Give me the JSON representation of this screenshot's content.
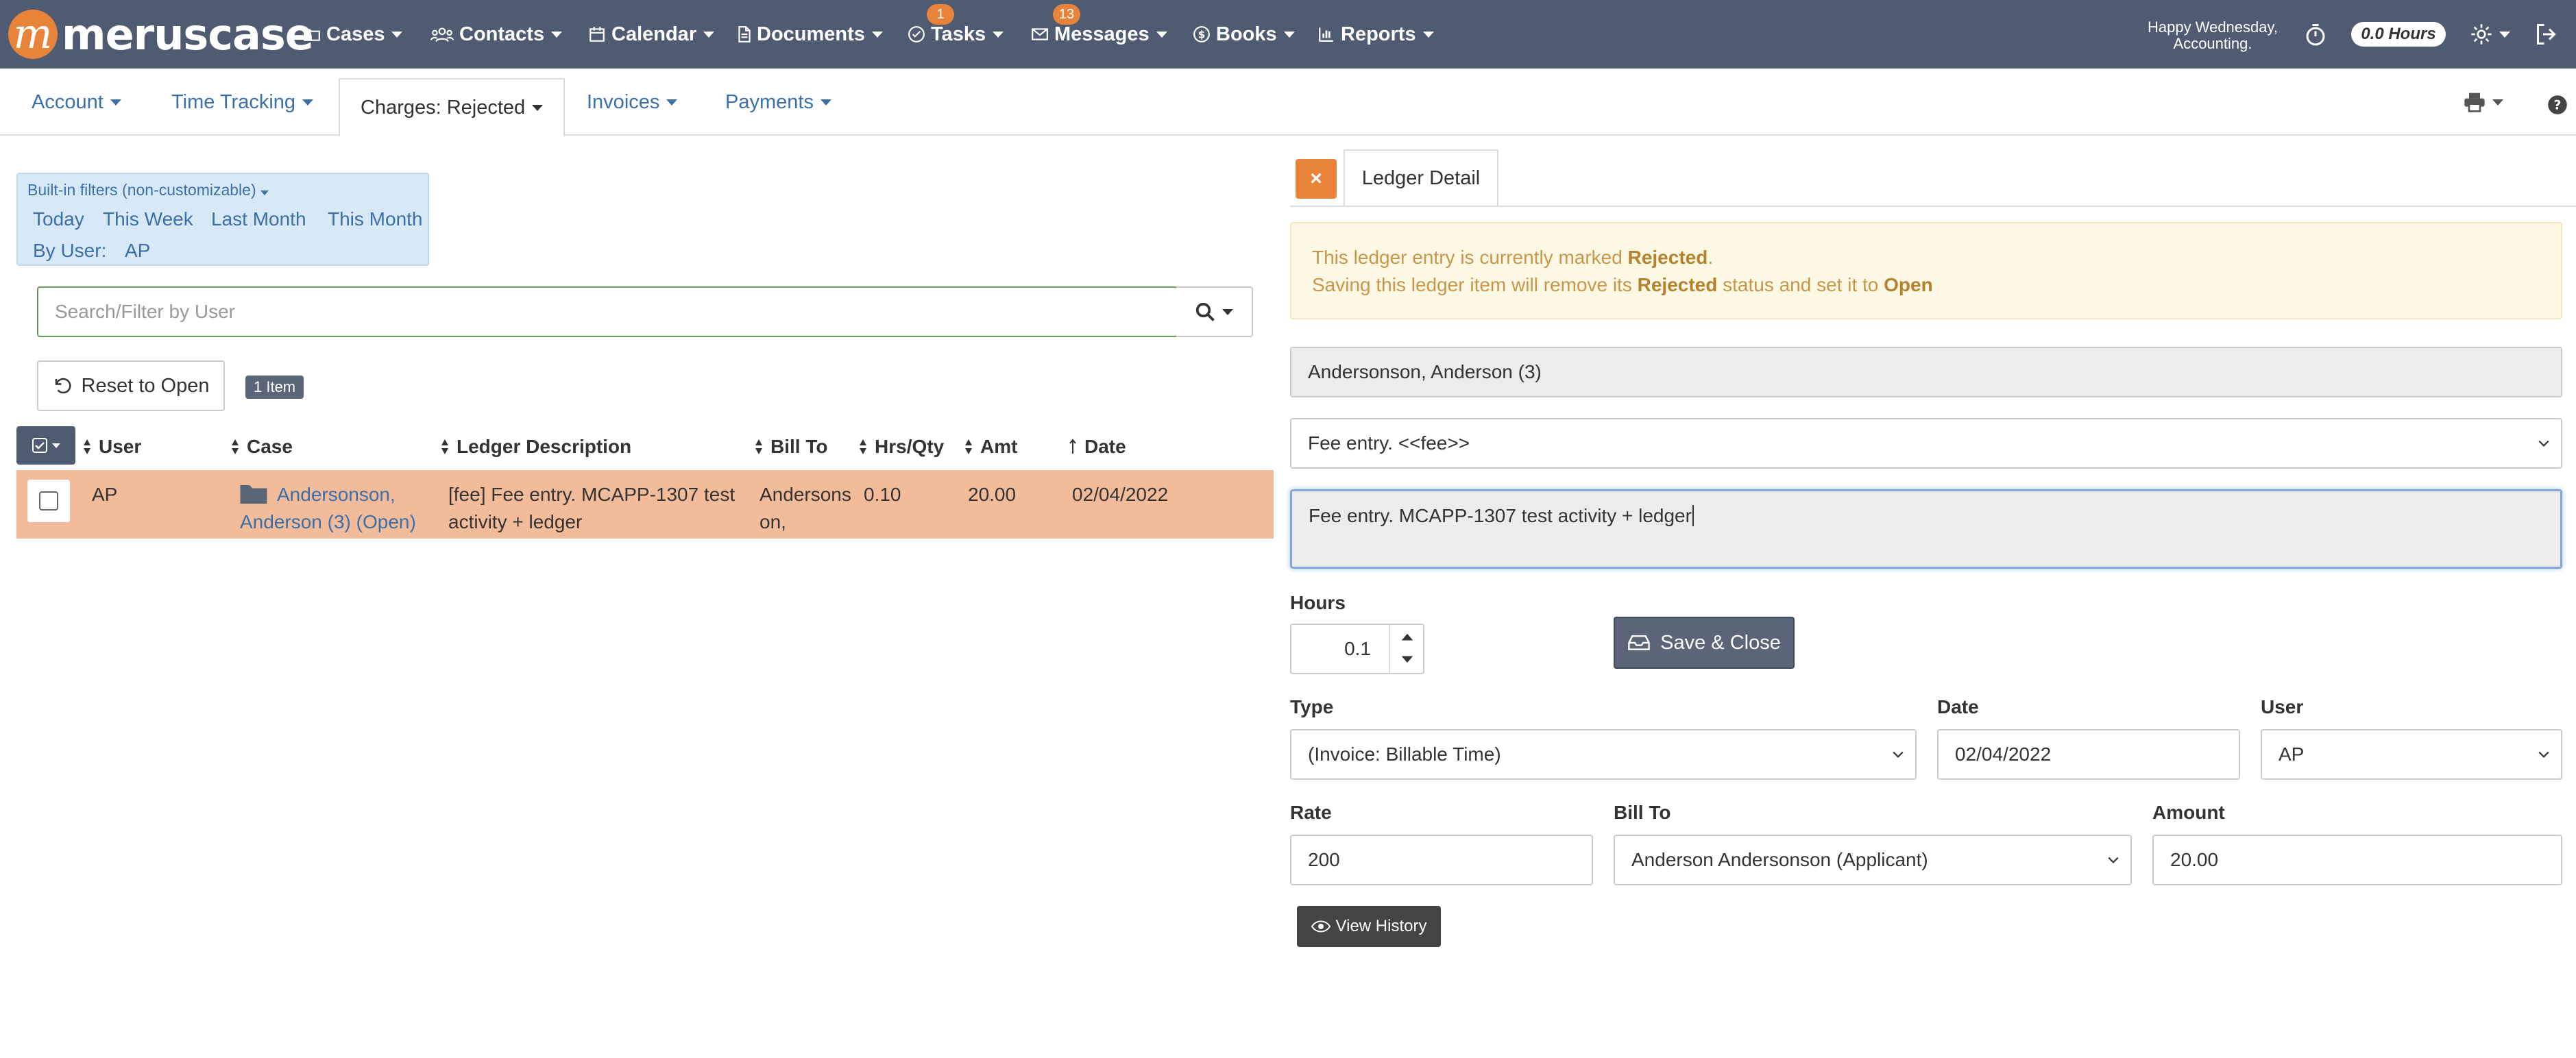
{
  "app": {
    "logo_text": "meruscase",
    "logo_mark": "m"
  },
  "nav": {
    "items": [
      {
        "label": "Cases",
        "icon": "folder-icon"
      },
      {
        "label": "Contacts",
        "icon": "contacts-icon"
      },
      {
        "label": "Calendar",
        "icon": "calendar-icon"
      },
      {
        "label": "Documents",
        "icon": "document-icon"
      },
      {
        "label": "Tasks",
        "icon": "check-circle-icon",
        "badge": "1"
      },
      {
        "label": "Messages",
        "icon": "envelope-icon",
        "badge": "13"
      },
      {
        "label": "Books",
        "icon": "dollar-icon"
      },
      {
        "label": "Reports",
        "icon": "bar-chart-icon"
      }
    ],
    "greeting_line1": "Happy Wednesday,",
    "greeting_line2": "Accounting.",
    "hours": "0.0 Hours"
  },
  "subnav": {
    "tabs": [
      {
        "label": "Account"
      },
      {
        "label": "Time Tracking"
      },
      {
        "label": "Charges: Rejected"
      },
      {
        "label": "Invoices"
      },
      {
        "label": "Payments"
      }
    ]
  },
  "filters": {
    "title": "Built-in filters (non-customizable)",
    "links": [
      "Today",
      "This Week",
      "Last Month",
      "This Month"
    ],
    "by_user_label": "By User:",
    "by_user_value": "AP"
  },
  "search": {
    "placeholder": "Search/Filter by User"
  },
  "reset_label": "Reset to Open",
  "count_label": "1 Item",
  "table": {
    "headers": [
      "User",
      "Case",
      "Ledger Description",
      "Bill To",
      "Hrs/Qty",
      "Amt",
      "Date"
    ],
    "row": {
      "user": "AP",
      "case_line1": "Andersonson,",
      "case_line2": "Anderson (3) (Open)",
      "desc_line1": "[fee] Fee entry. MCAPP-1307 test",
      "desc_line2": "activity + ledger",
      "billto_line1": "Andersons",
      "billto_line2": "on,",
      "hrs": "0.10",
      "amt": "20.00",
      "date": "02/04/2022"
    }
  },
  "detail": {
    "close": "×",
    "tab_label": "Ledger Detail",
    "alert_line1_pre": "This ledger entry is currently marked ",
    "alert_line1_bold": "Rejected",
    "alert_line1_post": ".",
    "alert_line2_pre": "Saving this ledger item will remove its ",
    "alert_line2_bold1": "Rejected",
    "alert_line2_mid": " status and set it to ",
    "alert_line2_bold2": "Open",
    "case_value": "Andersonson, Anderson (3)",
    "fee_select": "Fee entry. <<fee>>",
    "description": "Fee entry.  MCAPP-1307 test activity + ledger",
    "hours_label": "Hours",
    "hours_value": "0.1",
    "save_label": "Save & Close",
    "type_label": "Type",
    "type_value": "(Invoice: Billable Time)",
    "date_label": "Date",
    "date_value": "02/04/2022",
    "user_label": "User",
    "user_value": "AP",
    "rate_label": "Rate",
    "rate_value": "200",
    "billto_label": "Bill To",
    "billto_value": "Anderson Andersonson (Applicant)",
    "amount_label": "Amount",
    "amount_value": "20.00",
    "history_label": "View History"
  },
  "colors": {
    "nav_bg": "#4f5b70",
    "accent": "#e8843a",
    "row_highlight": "#f2bc9a",
    "link": "#3a6fa8"
  }
}
